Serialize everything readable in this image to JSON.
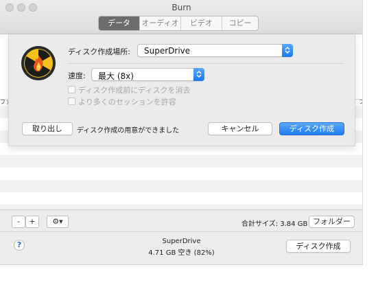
{
  "window": {
    "title": "Burn"
  },
  "tabs": [
    {
      "label": "データ",
      "active": true
    },
    {
      "label": "オーディオ",
      "active": false
    },
    {
      "label": "ビデオ",
      "active": false
    },
    {
      "label": "コピー",
      "active": false
    }
  ],
  "list_edge_glyphs": {
    "left": "ファ",
    "right": "フ"
  },
  "sheet": {
    "location_label": "ディスク作成場所:",
    "location_value": "SuperDrive",
    "speed_label": "速度:",
    "speed_value": "最大 (8x)",
    "checkbox_erase": "ディスク作成前にディスクを消去",
    "checkbox_sessions": "より多くのセッションを許容",
    "eject_button": "取り出し",
    "status_text": "ディスク作成の用意ができました",
    "cancel_button": "キャンセル",
    "burn_button": "ディスク作成"
  },
  "bottom": {
    "remove_button": "-",
    "add_button": "+",
    "gear_button": "⚙▾",
    "total_size": "合計サイズ: 3.84 GB",
    "folder_button": "フォルダー",
    "help_button": "?",
    "drive_name": "SuperDrive",
    "drive_free": "4.71 GB 空き (82%)",
    "burn_button": "ディスク作成"
  },
  "colors": {
    "accent_blue": "#1f7cf2",
    "active_segment": "#6c6c6c"
  }
}
